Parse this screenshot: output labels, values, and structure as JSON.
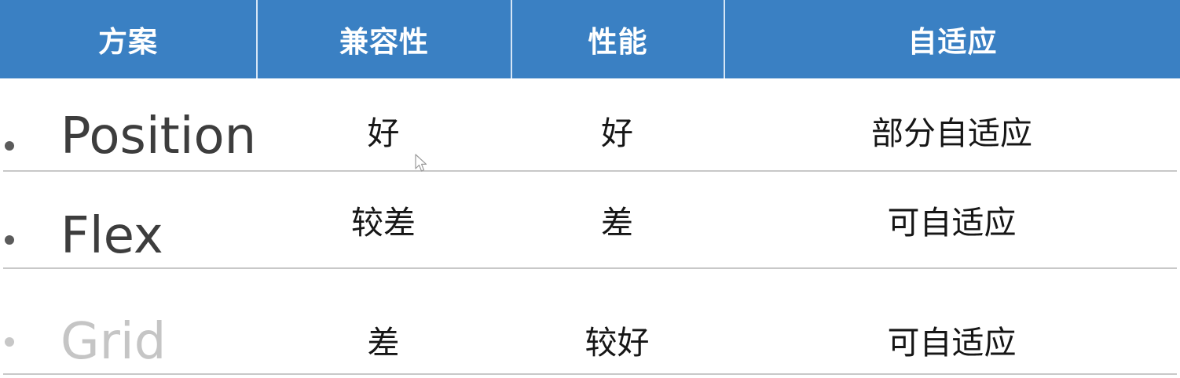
{
  "table": {
    "headers": [
      "方案",
      "兼容性",
      "性能",
      "自适应"
    ],
    "rows": [
      {
        "name": "Position",
        "compatibility": "好",
        "performance": "好",
        "adaptive": "部分自适应"
      },
      {
        "name": "Flex",
        "compatibility": "较差",
        "performance": "差",
        "adaptive": "可自适应"
      },
      {
        "name": "Grid",
        "compatibility": "差",
        "performance": "较好",
        "adaptive": "可自适应"
      }
    ]
  },
  "icons": {
    "bullet": "bullet-dot-icon",
    "cursor": "mouse-pointer-icon"
  },
  "colors": {
    "header_background": "#3a80c3",
    "header_text": "#ffffff",
    "row_divider": "#c8c8c8",
    "dimmed_text": "#c5c5c5"
  }
}
